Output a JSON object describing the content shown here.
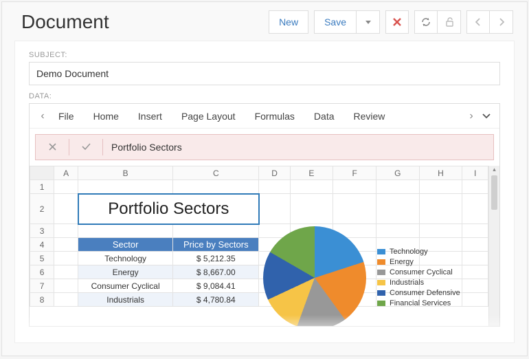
{
  "title": "Document",
  "toolbar": {
    "new": "New",
    "save": "Save"
  },
  "form": {
    "subject_label": "SUBJECT:",
    "subject_value": "Demo Document",
    "data_label": "DATA:"
  },
  "spreadsheet": {
    "tabs": [
      "File",
      "Home",
      "Insert",
      "Page Layout",
      "Formulas",
      "Data",
      "Review"
    ],
    "formula_value": "Portfolio Sectors",
    "columns": [
      "A",
      "B",
      "C",
      "D",
      "E",
      "F",
      "G",
      "H",
      "I"
    ],
    "rows": [
      "1",
      "2",
      "3",
      "4",
      "5",
      "6",
      "7",
      "8"
    ],
    "merged_title": "Portfolio Sectors",
    "header": {
      "sector": "Sector",
      "price": "Price by Sectors"
    },
    "data_rows": [
      {
        "sector": "Technology",
        "price": "$ 5,212.35"
      },
      {
        "sector": "Energy",
        "price": "$ 8,667.00"
      },
      {
        "sector": "Consumer Cyclical",
        "price": "$ 9,084.41"
      },
      {
        "sector": "Industrials",
        "price": "$ 4,780.84"
      }
    ]
  },
  "chart_data": {
    "type": "pie",
    "title": "",
    "series": [
      {
        "name": "Technology",
        "color": "#3b8fd4",
        "value": 5212.35
      },
      {
        "name": "Energy",
        "color": "#ef8b2c",
        "value": 8667.0
      },
      {
        "name": "Consumer Cyclical",
        "color": "#989898",
        "value": 9084.41
      },
      {
        "name": "Industrials",
        "color": "#f6c447",
        "value": 4780.84
      },
      {
        "name": "Consumer Defensive",
        "color": "#3062ac",
        "value": null
      },
      {
        "name": "Financial Services",
        "color": "#6fa64a",
        "value": null
      }
    ]
  }
}
